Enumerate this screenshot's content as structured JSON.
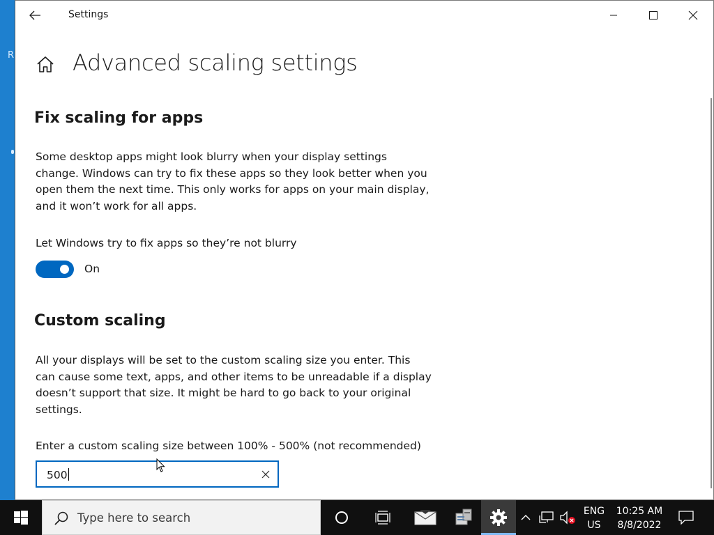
{
  "window": {
    "title": "Settings"
  },
  "page": {
    "title": "Advanced scaling settings"
  },
  "fix_scaling": {
    "heading": "Fix scaling for apps",
    "description_lines": [
      "Some desktop apps might look blurry when your display settings",
      "change. Windows can try to fix these apps so they look better when you",
      "open them the next time. This only works for apps on your main display,",
      "and it won’t work for all apps."
    ],
    "toggle_label": "Let Windows try to fix apps so they’re not blurry",
    "toggle_state": "On",
    "toggle_on": true
  },
  "custom_scaling": {
    "heading": "Custom scaling",
    "description_lines": [
      "All your displays will be set to the custom scaling size you enter. This",
      "can cause some text, apps, and other items to be unreadable if a display",
      "doesn’t support that size. It might be hard to go back to your original",
      "settings."
    ],
    "input_label": "Enter a custom scaling size between 100% - 500% (not recommended)",
    "input_value": "500"
  },
  "taskbar": {
    "search_placeholder": "Type here to search",
    "language_line1": "ENG",
    "language_line2": "US",
    "time": "10:25 AM",
    "date": "8/8/2022"
  },
  "desktop": {
    "partial_icon_letter": "R"
  },
  "colors": {
    "accent": "#0067c0",
    "taskbar": "#101010",
    "desktop": "#1a7fd0"
  }
}
